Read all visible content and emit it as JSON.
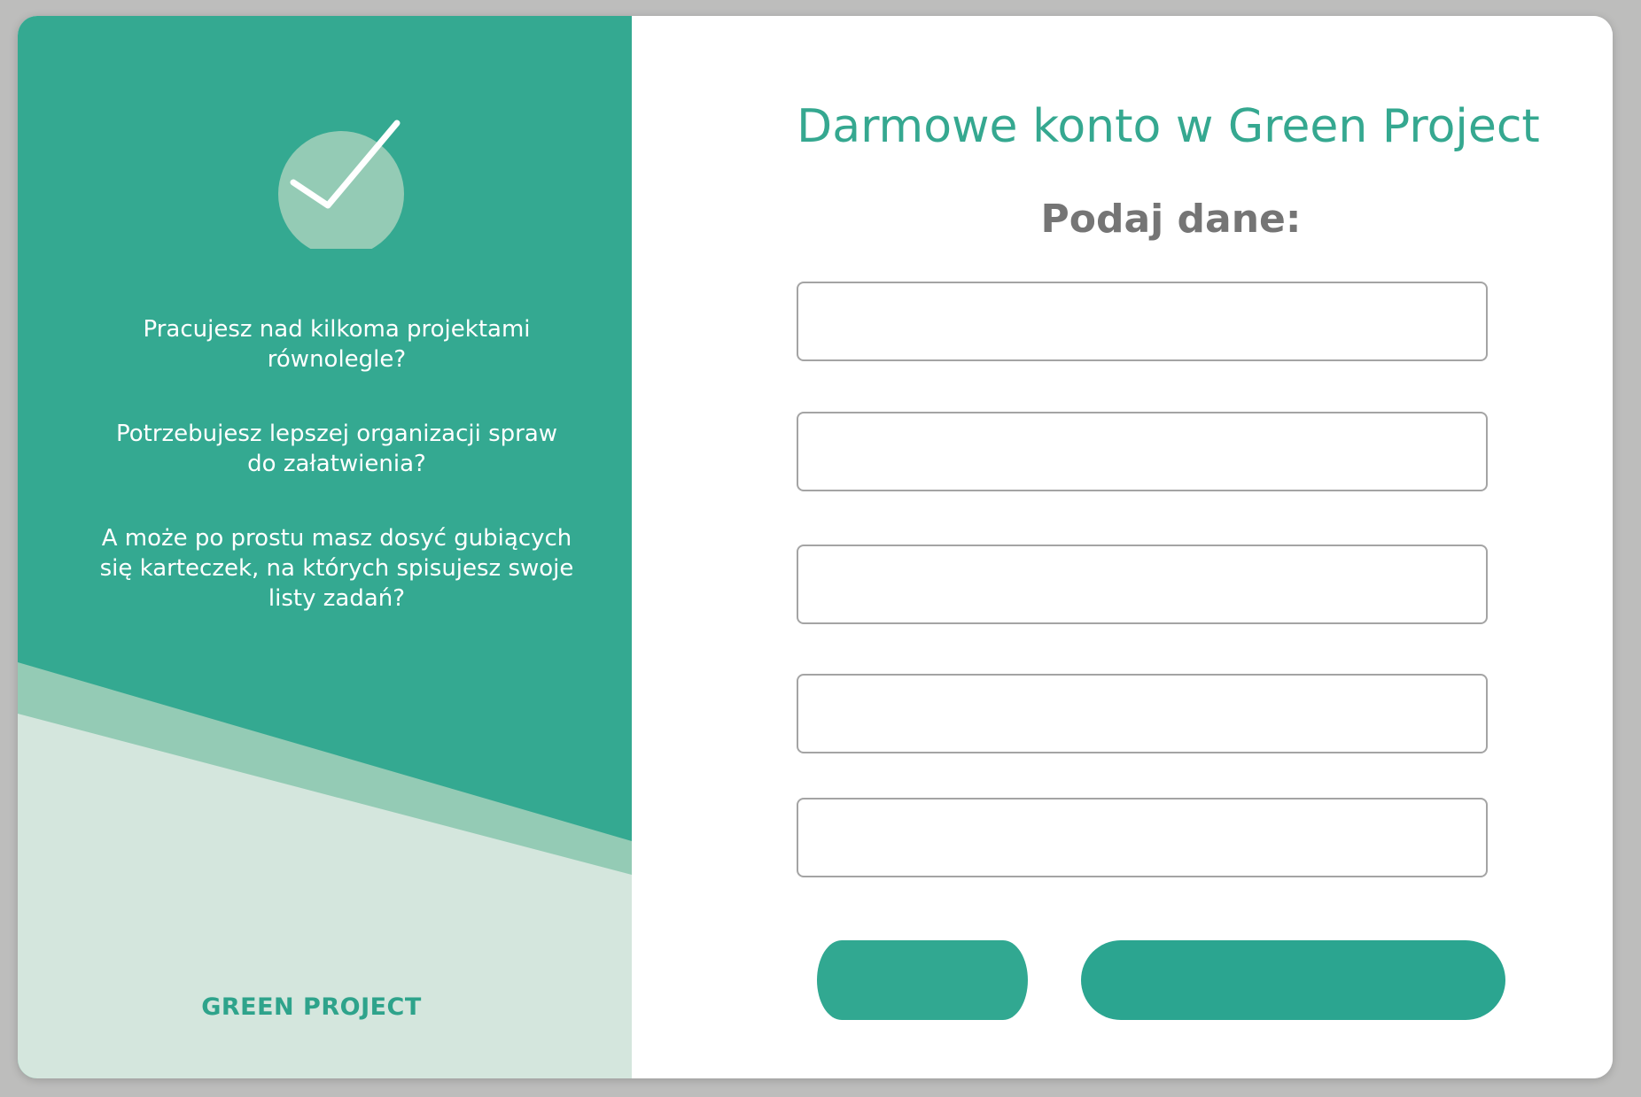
{
  "promo": {
    "line_1": "Pracujesz nad kilkoma projektami równolegle?",
    "line_2": "Potrzebujesz lepszej organizacji spraw do załatwienia?",
    "line_3": "A może po prostu masz dosyć gubiących się karteczek, na których spisujesz swoje listy zadań?",
    "brand": "GREEN PROJECT",
    "badge_icon": "checkmark-icon"
  },
  "form": {
    "title": "Darmowe konto w Green Project",
    "subtitle": "Podaj dane:",
    "fields": [
      {
        "value": "",
        "placeholder": ""
      },
      {
        "value": "",
        "placeholder": ""
      },
      {
        "value": "",
        "placeholder": ""
      },
      {
        "value": "",
        "placeholder": ""
      },
      {
        "value": "",
        "placeholder": ""
      }
    ],
    "secondary_button_label": "",
    "primary_button_label": ""
  },
  "colors": {
    "primary_green": "#34a991",
    "mid_green": "#94cbb5",
    "light_green": "#d4e6dd",
    "title_green": "#35a890",
    "subtitle_gray": "#757575",
    "page_background": "#bdbdbc"
  }
}
